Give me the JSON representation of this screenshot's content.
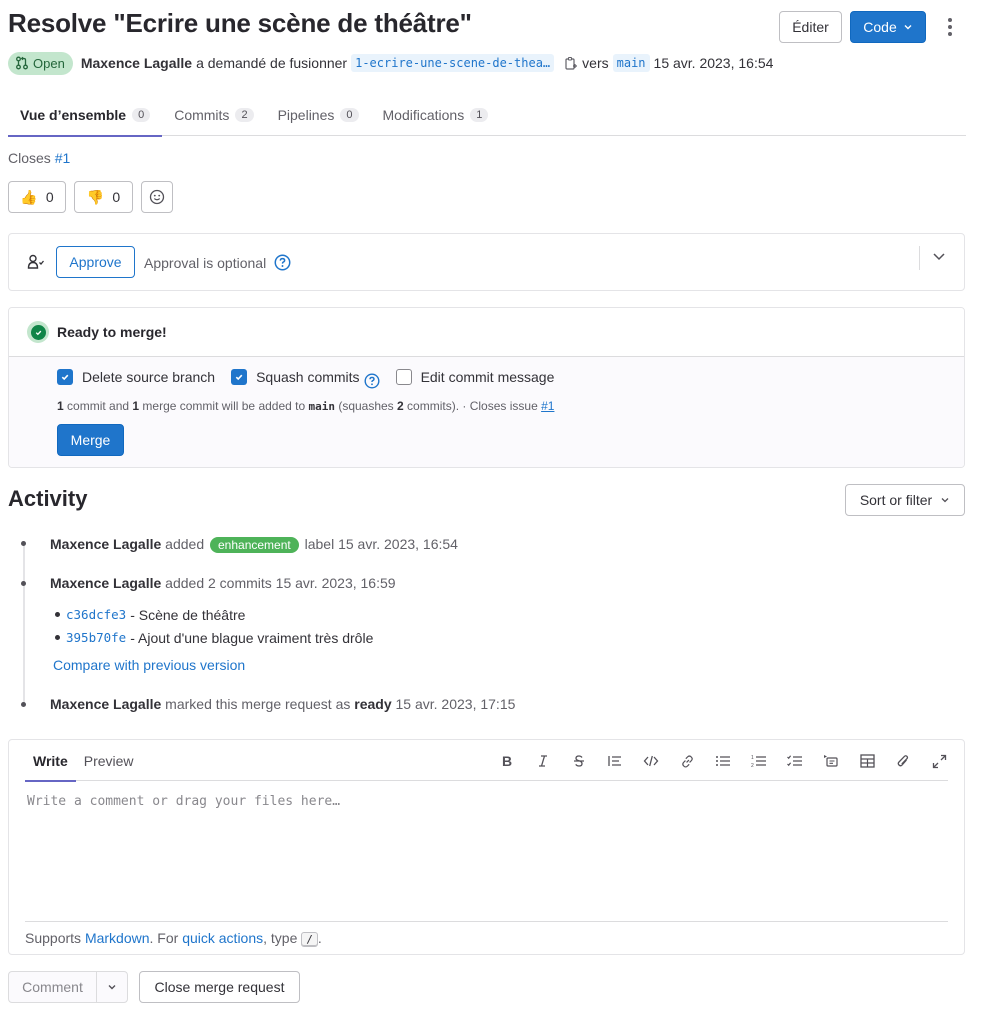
{
  "header": {
    "title": "Resolve \"Ecrire une scène de théâtre\"",
    "edit_label": "Éditer",
    "code_label": "Code",
    "status_label": "Open",
    "author": "Maxence Lagalle",
    "action_text": "a demandé de fusionner",
    "source_branch": "1-ecrire-une-scene-de-thea…",
    "to_text": "vers",
    "target_branch": "main",
    "created_at": "15 avr. 2023, 16:54"
  },
  "tabs": [
    {
      "label": "Vue d’ensemble",
      "count": "0",
      "active": true
    },
    {
      "label": "Commits",
      "count": "2"
    },
    {
      "label": "Pipelines",
      "count": "0"
    },
    {
      "label": "Modifications",
      "count": "1"
    }
  ],
  "description": {
    "closes_label": "Closes",
    "issue_ref": "#1"
  },
  "awards": {
    "thumbs_up": {
      "emoji": "👍",
      "count": "0"
    },
    "thumbs_down": {
      "emoji": "👎",
      "count": "0"
    }
  },
  "approval": {
    "approve_label": "Approve",
    "status_text": "Approval is optional"
  },
  "merge_widget": {
    "status": "Ready to merge!",
    "options": [
      {
        "label": "Delete source branch",
        "checked": true
      },
      {
        "label": "Squash commits",
        "checked": true
      },
      {
        "label": "Edit commit message",
        "checked": false
      }
    ],
    "info": {
      "commits": "1",
      "t1": " commit and ",
      "merge_commits": "1",
      "t2": " merge commit will be added to ",
      "branch": "main",
      "t3": " (squashes ",
      "squashed": "2",
      "t4": " commits). · Closes issue ",
      "issue": "#1"
    },
    "merge_label": "Merge"
  },
  "activity": {
    "title": "Activity",
    "sort_label": "Sort or filter",
    "items": [
      {
        "author": "Maxence Lagalle",
        "pre": "added",
        "label": "enhancement",
        "post": "label 15 avr. 2023, 16:54"
      },
      {
        "author": "Maxence Lagalle",
        "text": "added 2 commits 15 avr. 2023, 16:59",
        "commits": [
          {
            "sha": "c36dcfe3",
            "message": "- Scène de théâtre"
          },
          {
            "sha": "395b70fe",
            "message": "- Ajout d'une blague vraiment très drôle"
          }
        ],
        "compare_label": "Compare with previous version"
      },
      {
        "author": "Maxence Lagalle",
        "pre": "marked this merge request as",
        "strong": "ready",
        "post": "15 avr. 2023, 17:15"
      }
    ]
  },
  "editor": {
    "write_tab": "Write",
    "preview_tab": "Preview",
    "placeholder": "Write a comment or drag your files here…",
    "footer_supports": "Supports",
    "markdown_link": "Markdown",
    "footer_mid": ". For",
    "quick_actions_link": "quick actions",
    "footer_type": ", type",
    "slash": "/",
    "footer_end": "."
  },
  "actions": {
    "comment_label": "Comment",
    "close_label": "Close merge request"
  },
  "colors": {
    "primary": "#1f75cb",
    "success": "#108548",
    "label_enhancement": "#4eb359",
    "tab_underline": "#6666c4"
  }
}
